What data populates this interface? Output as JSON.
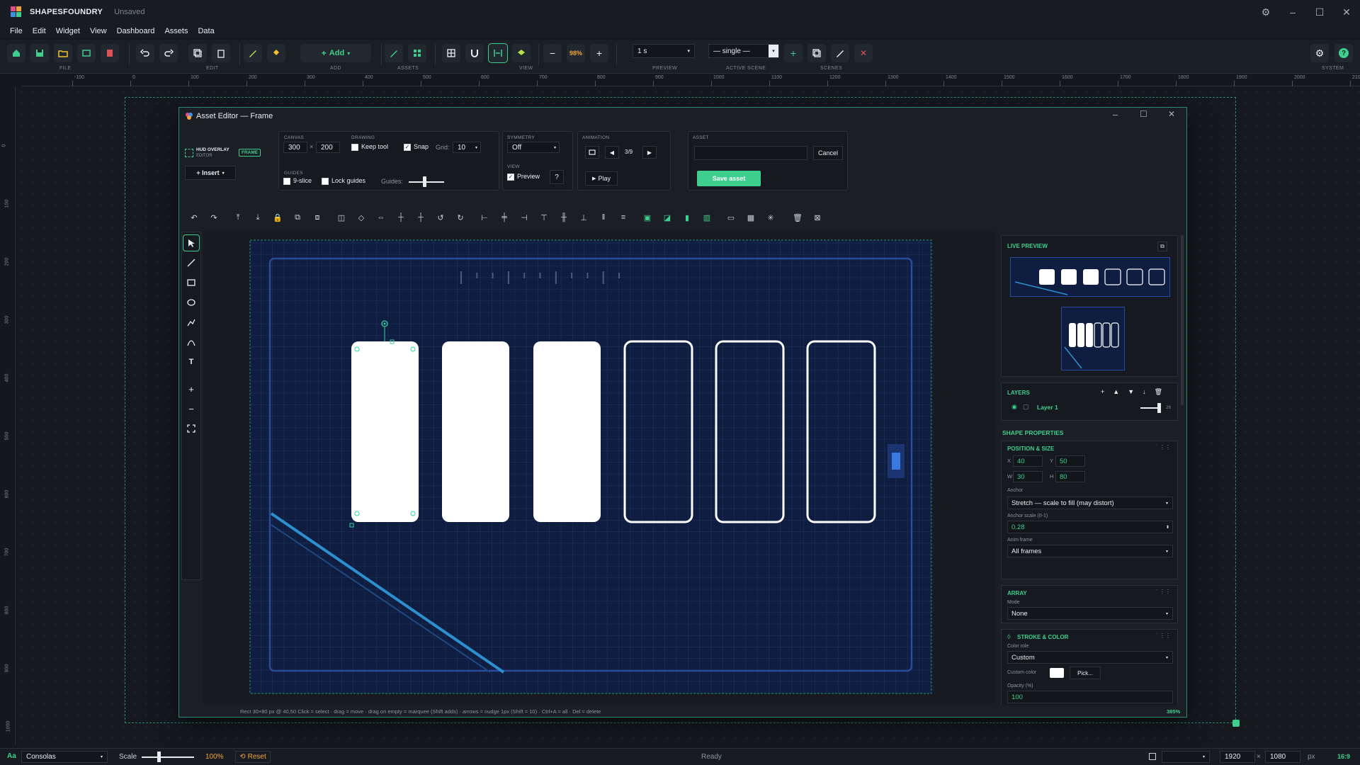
{
  "app": {
    "name": "SHAPESFOUNDRY",
    "doc_status": "Unsaved"
  },
  "menu": [
    "File",
    "Edit",
    "Widget",
    "View",
    "Dashboard",
    "Assets",
    "Data"
  ],
  "ribbon": {
    "add_label": "Add",
    "zoom": "98%",
    "preview_value": "1 s",
    "scene_value": "— single —",
    "groups": {
      "file": "FILE",
      "edit": "EDIT",
      "add": "ADD",
      "assets": "ASSETS",
      "view": "VIEW",
      "preview": "PREVIEW",
      "active_scene": "ACTIVE SCENE",
      "scenes": "SCENES",
      "system": "SYSTEM"
    }
  },
  "rulers": {
    "h": [
      "-100",
      "0",
      "100",
      "200",
      "300",
      "400",
      "500",
      "600",
      "700",
      "800",
      "900",
      "1000",
      "1100",
      "1200",
      "1300",
      "1400",
      "1500",
      "1600",
      "1700",
      "1800",
      "1900",
      "2000",
      "2100"
    ],
    "v": [
      "0",
      "100",
      "200",
      "300",
      "400",
      "500",
      "600",
      "700",
      "800",
      "900",
      "1000"
    ]
  },
  "editor": {
    "title": "Asset Editor — Frame",
    "mode_line1": "HUD OVERLAY",
    "mode_line2": "EDITOR",
    "mode_badge": "FRAME",
    "insert_label": "+ Insert",
    "canvas": {
      "label": "CANVAS",
      "w": "300",
      "h": "200",
      "x": "×"
    },
    "drawing": {
      "label": "DRAWING",
      "keep_tool": "Keep tool",
      "snap": "Snap",
      "grid_label": "Grid:",
      "grid_value": "10"
    },
    "guides": {
      "label": "GUIDES",
      "nine_slice": "9-slice",
      "lock_guides": "Lock guides",
      "guides_label": "Guides:"
    },
    "symmetry": {
      "label": "SYMMETRY",
      "value": "Off"
    },
    "view": {
      "label": "VIEW",
      "preview": "Preview",
      "help": "?"
    },
    "animation": {
      "label": "ANIMATION",
      "frame": "3/9",
      "play": "Play"
    },
    "asset": {
      "label": "ASSET",
      "name": "",
      "cancel": "Cancel",
      "save": "Save asset"
    },
    "status_text": "Rect  30×80 px  @ 40,50     Click = select · drag = move · drag on empty = marquee (Shift adds) · arrows = nudge 1px (Shift = 10) · Ctrl+A = all · Del = delete",
    "zoom_pct": "385%"
  },
  "right": {
    "live_preview": "LIVE PREVIEW",
    "layers": "LAYERS",
    "layer_name": "Layer 1",
    "layer_opacity": "26",
    "shape_props": "SHAPE PROPERTIES",
    "pos_size": "POSITION & SIZE",
    "x_lbl": "X",
    "x": "40",
    "y_lbl": "Y",
    "y": "50",
    "w_lbl": "W",
    "w": "30",
    "h_lbl": "H",
    "h": "80",
    "anchor_label": "Anchor",
    "anchor_value": "Stretch  —  scale to fill (may distort)",
    "anchor_scale_label": "Anchor scale (0-1)",
    "anchor_scale_value": "0.28",
    "anim_frame_label": "Anim frame",
    "anim_frame_value": "All frames",
    "array": "ARRAY",
    "mode_label": "Mode",
    "mode_value": "None",
    "stroke_color": "STROKE & COLOR",
    "color_role_label": "Color role",
    "color_role_value": "Custom",
    "custom_color_label": "Custom color",
    "pick_label": "Pick...",
    "opacity_label": "Opacity (%)",
    "opacity_value": "100"
  },
  "statusbar": {
    "font_icon": "Aa",
    "font_value": "Consolas",
    "scale_label": "Scale",
    "scale_value": "100%",
    "reset_label": "Reset",
    "ready": "Ready",
    "width": "1920",
    "x_sep": "×",
    "height": "1080",
    "unit": "px",
    "aspect": "16:9"
  },
  "colors": {
    "accent": "#3ecf8e",
    "canvas_bg": "#0f1f45",
    "selection": "#2fd6a6",
    "diag_line": "#2e8fcf"
  }
}
